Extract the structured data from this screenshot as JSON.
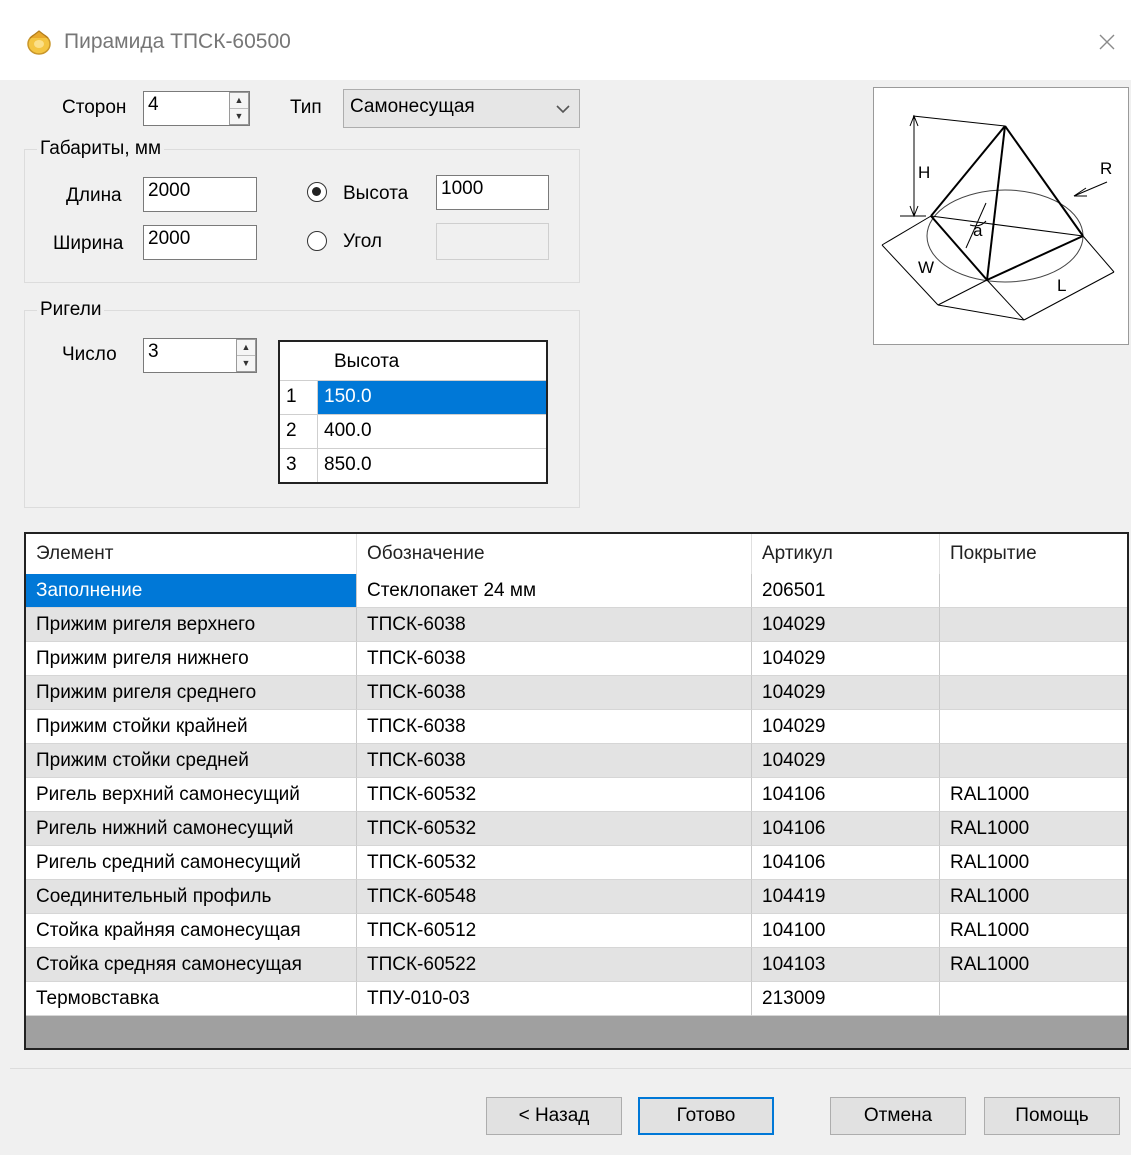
{
  "window": {
    "title": "Пирамида ТПСК-60500"
  },
  "top": {
    "sides_label": "Сторон",
    "sides_value": "4",
    "type_label": "Тип",
    "type_value": "Самонесущая"
  },
  "dimensions": {
    "group_title": "Габариты, мм",
    "length_label": "Длина",
    "length_value": "2000",
    "width_label": "Ширина",
    "width_value": "2000",
    "height_label": "Высота",
    "height_value": "1000",
    "height_selected": true,
    "angle_label": "Угол",
    "angle_value": ""
  },
  "transoms": {
    "group_title": "Ригели",
    "count_label": "Число",
    "count_value": "3",
    "grid_header": "Высота",
    "rows": [
      {
        "n": "1",
        "value": "150.0"
      },
      {
        "n": "2",
        "value": "400.0"
      },
      {
        "n": "3",
        "value": "850.0"
      }
    ]
  },
  "diagram": {
    "labels": {
      "h": "H",
      "r": "R",
      "a": "a",
      "w": "W",
      "l": "L"
    }
  },
  "table": {
    "columns": [
      "Элемент",
      "Обозначение",
      "Артикул",
      "Покрытие"
    ],
    "rows": [
      [
        "Заполнение",
        "Стеклопакет 24 мм",
        "206501",
        ""
      ],
      [
        "Прижим ригеля верхнего",
        "ТПСК-6038",
        "104029",
        ""
      ],
      [
        "Прижим ригеля нижнего",
        "ТПСК-6038",
        "104029",
        ""
      ],
      [
        "Прижим ригеля среднего",
        "ТПСК-6038",
        "104029",
        ""
      ],
      [
        "Прижим стойки крайней",
        "ТПСК-6038",
        "104029",
        ""
      ],
      [
        "Прижим стойки средней",
        "ТПСК-6038",
        "104029",
        ""
      ],
      [
        "Ригель верхний самонесущий",
        "ТПСК-60532",
        "104106",
        "RAL1000"
      ],
      [
        "Ригель нижний самонесущий",
        "ТПСК-60532",
        "104106",
        "RAL1000"
      ],
      [
        "Ригель средний самонесущий",
        "ТПСК-60532",
        "104106",
        "RAL1000"
      ],
      [
        "Соединительный профиль",
        "ТПСК-60548",
        "104419",
        "RAL1000"
      ],
      [
        "Стойка крайняя самонесущая",
        "ТПСК-60512",
        "104100",
        "RAL1000"
      ],
      [
        "Стойка средняя самонесущая",
        "ТПСК-60522",
        "104103",
        "RAL1000"
      ],
      [
        "Термовставка",
        "ТПУ-010-03",
        "213009",
        ""
      ]
    ]
  },
  "buttons": {
    "back": "< Назад",
    "finish": "Готово",
    "cancel": "Отмена",
    "help": "Помощь"
  },
  "colors": {
    "selection": "#0078d7",
    "alt_row": "#e3e3e3",
    "background": "#f0f0f0"
  }
}
